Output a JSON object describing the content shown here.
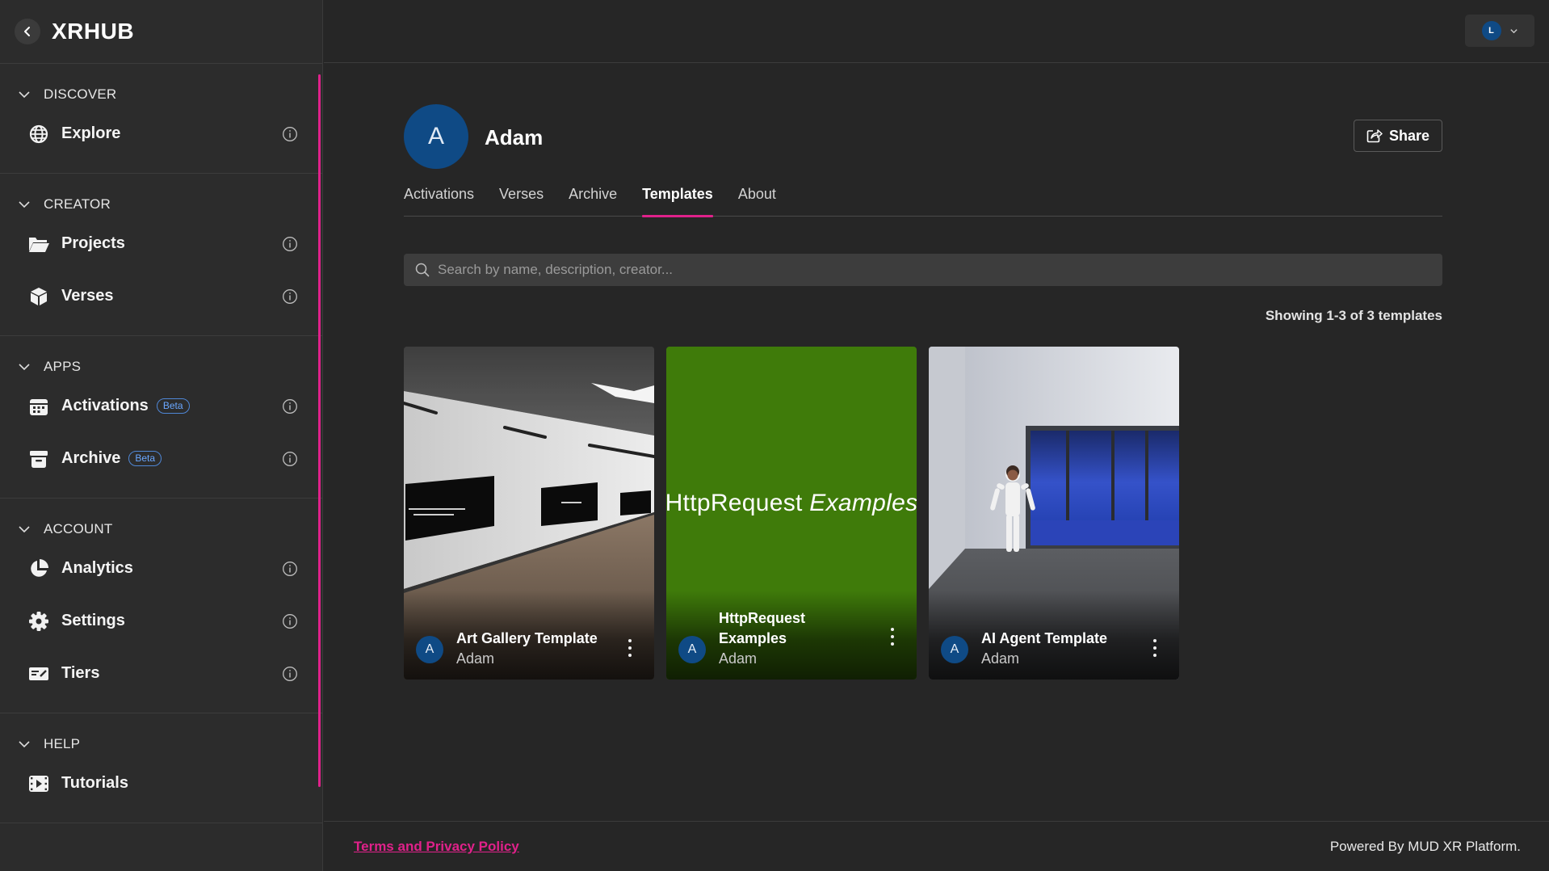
{
  "app": {
    "brand": "XRHUB",
    "accent_color": "#e0218a",
    "avatar_color": "#0f4a85"
  },
  "sidebar": {
    "sections": [
      {
        "title": "DISCOVER",
        "items": [
          {
            "label": "Explore",
            "icon": "globe-icon"
          }
        ]
      },
      {
        "title": "CREATOR",
        "items": [
          {
            "label": "Projects",
            "icon": "folder-icon"
          },
          {
            "label": "Verses",
            "icon": "cube-icon"
          }
        ]
      },
      {
        "title": "APPS",
        "items": [
          {
            "label": "Activations",
            "icon": "calendar-icon",
            "badge": "Beta"
          },
          {
            "label": "Archive",
            "icon": "archive-icon",
            "badge": "Beta"
          }
        ]
      },
      {
        "title": "ACCOUNT",
        "items": [
          {
            "label": "Analytics",
            "icon": "pie-chart-icon"
          },
          {
            "label": "Settings",
            "icon": "gear-icon"
          },
          {
            "label": "Tiers",
            "icon": "ticket-icon"
          }
        ]
      },
      {
        "title": "HELP",
        "items": [
          {
            "label": "Tutorials",
            "icon": "film-icon"
          }
        ]
      }
    ]
  },
  "topbar": {
    "user_initial": "L"
  },
  "profile": {
    "initial": "A",
    "name": "Adam",
    "share_label": "Share"
  },
  "tabs": [
    {
      "label": "Activations",
      "active": false
    },
    {
      "label": "Verses",
      "active": false
    },
    {
      "label": "Archive",
      "active": false
    },
    {
      "label": "Templates",
      "active": true
    },
    {
      "label": "About",
      "active": false
    }
  ],
  "search": {
    "placeholder": "Search by name, description, creator..."
  },
  "results": {
    "summary": "Showing 1-3 of 3 templates"
  },
  "cards": [
    {
      "title": "Art Gallery Template",
      "creator": "Adam",
      "initial": "A",
      "thumb": "art-gallery"
    },
    {
      "title": "HttpRequest Examples",
      "creator": "Adam",
      "initial": "A",
      "thumb": "green",
      "thumb_text_plain": "HttpRequest ",
      "thumb_text_italic": "Examples"
    },
    {
      "title": "AI Agent Template",
      "creator": "Adam",
      "initial": "A",
      "thumb": "ai-agent"
    }
  ],
  "footer": {
    "terms_label": "Terms and Privacy Policy",
    "powered_by": "Powered By MUD XR Platform."
  }
}
